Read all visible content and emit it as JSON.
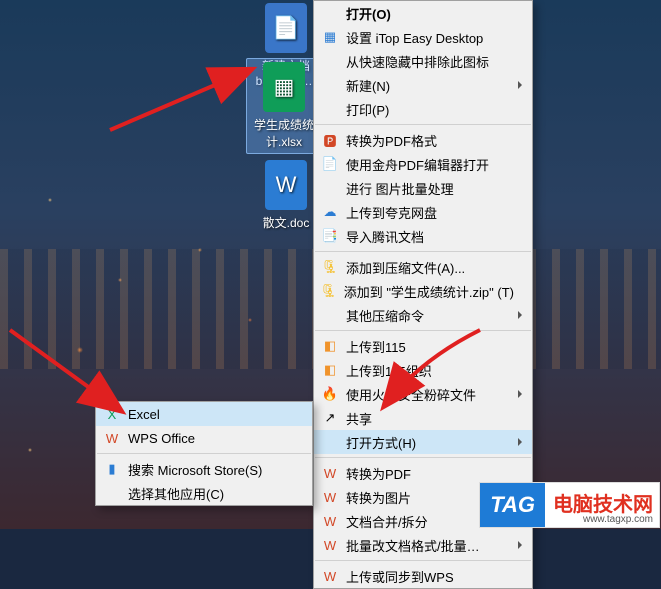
{
  "desktop": {
    "icons": [
      {
        "label": "新建文档",
        "label2": "backup.p…",
        "type": "txt"
      },
      {
        "label": "学生成绩\n计.xlsx",
        "type": "xlsx",
        "selected": true
      },
      {
        "label": "散文.doc",
        "type": "doc"
      }
    ]
  },
  "menu_main": {
    "items": [
      {
        "label": "打开(O)",
        "bold": true
      },
      {
        "label": "设置 iTop Easy Desktop",
        "icon": "grid-icon",
        "color": "i-blue"
      },
      {
        "label": "从快速隐藏中排除此图标"
      },
      {
        "label": "新建(N)",
        "sub": true
      },
      {
        "label": "打印(P)"
      },
      {
        "sep": true
      },
      {
        "label": "转换为PDF格式",
        "icon": "pdf-icon",
        "color": "i-red"
      },
      {
        "label": "使用金舟PDF编辑器打开",
        "icon": "pdf-edit-icon",
        "color": "i-blue"
      },
      {
        "label": "进行 图片批量处理"
      },
      {
        "label": "上传到夸克网盘",
        "icon": "cloud-icon",
        "color": "i-blue"
      },
      {
        "label": "导入腾讯文档",
        "icon": "tencent-doc-icon",
        "color": "i-teal"
      },
      {
        "sep": true
      },
      {
        "label": "添加到压缩文件(A)...",
        "icon": "archive-icon",
        "color": "i-yellow"
      },
      {
        "label": "添加到 \"学生成绩统计.zip\" (T)",
        "icon": "archive-icon",
        "color": "i-yellow"
      },
      {
        "label": "其他压缩命令",
        "sub": true
      },
      {
        "sep": true
      },
      {
        "label": "上传到115",
        "icon": "115-icon",
        "color": "i-orange"
      },
      {
        "label": "上传到115组织",
        "icon": "115-org-icon",
        "color": "i-orange"
      },
      {
        "label": "使用火绒安全粉碎文件",
        "icon": "shred-icon",
        "color": "i-orange",
        "sub": true
      },
      {
        "label": "共享",
        "icon": "share-icon"
      },
      {
        "label": "打开方式(H)",
        "highlight": true,
        "sub": true
      },
      {
        "sep": true
      },
      {
        "label": "转换为PDF",
        "icon": "wps-icon",
        "color": "i-red"
      },
      {
        "label": "转换为图片",
        "icon": "wps-icon",
        "color": "i-red"
      },
      {
        "label": "文档合并/拆分",
        "icon": "wps-icon",
        "color": "i-red",
        "sub": true
      },
      {
        "label": "批量改文档格式/批量…",
        "icon": "wps-icon",
        "color": "i-red",
        "sub": true,
        "cut": true
      },
      {
        "sep": true
      },
      {
        "label": "上传或同步到WPS",
        "icon": "wps-cloud-icon",
        "color": "i-red",
        "cut": true
      }
    ]
  },
  "menu_sub": {
    "items": [
      {
        "label": "Excel",
        "icon": "excel-icon",
        "color": "i-green",
        "highlight": true
      },
      {
        "label": "WPS Office",
        "icon": "wps-icon",
        "color": "i-red"
      },
      {
        "sep": true
      },
      {
        "label": "搜索 Microsoft Store(S)",
        "icon": "store-icon",
        "color": "i-blue"
      },
      {
        "label": "选择其他应用(C)"
      }
    ]
  },
  "tag": {
    "badge": "TAG",
    "text": "电脑技术网",
    "url": "www.tagxp.com"
  }
}
